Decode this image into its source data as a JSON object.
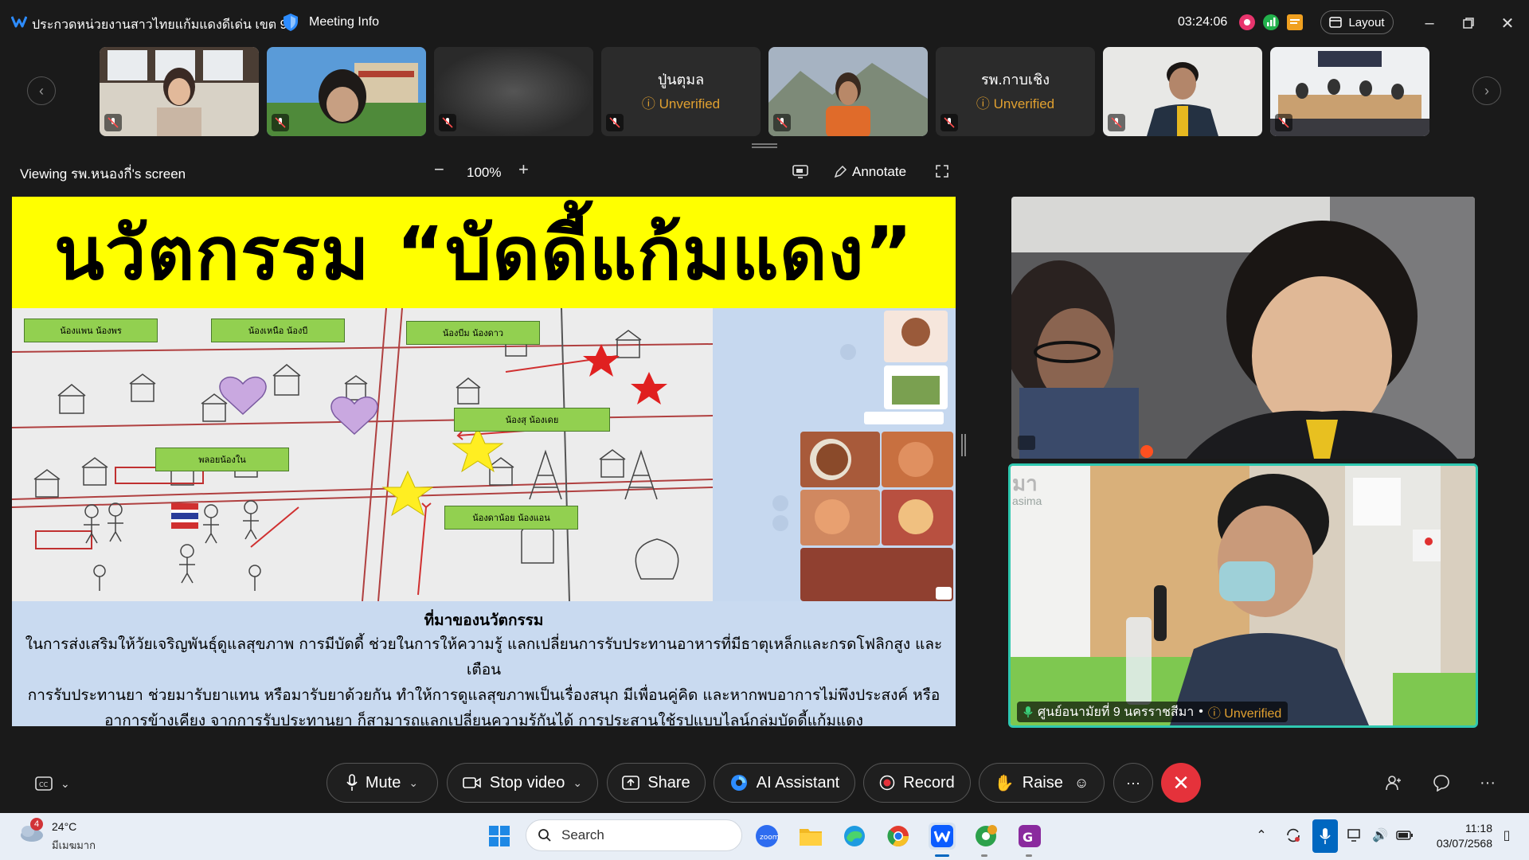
{
  "window": {
    "title": "ประกวดหน่วยงานสาวไทยแก้มแดงดีเด่น เขต 9",
    "meeting_info": "Meeting Info",
    "timer": "03:24:06",
    "layout_label": "Layout"
  },
  "participants": [
    {
      "name": "",
      "status": "",
      "muted": true,
      "kind": "video"
    },
    {
      "name": "",
      "status": "",
      "muted": true,
      "kind": "video"
    },
    {
      "name": "",
      "status": "",
      "muted": true,
      "kind": "video-dark"
    },
    {
      "name": "ปู่นตุมล",
      "status": "Unverified",
      "muted": true,
      "kind": "name"
    },
    {
      "name": "",
      "status": "",
      "muted": true,
      "kind": "video"
    },
    {
      "name": "รพ.กาบเชิง",
      "status": "Unverified",
      "muted": true,
      "kind": "name"
    },
    {
      "name": "",
      "status": "",
      "muted": true,
      "kind": "video"
    },
    {
      "name": "",
      "status": "",
      "muted": true,
      "kind": "video"
    }
  ],
  "share": {
    "viewing_label": "Viewing รพ.หนองกี่'s screen",
    "zoom": "100%",
    "annotate_label": "Annotate"
  },
  "slide": {
    "headline": "นวัตกรรม “บัดดี้แก้มแดง”",
    "map_labels": [
      "น้องแพน น้องพร",
      "น้องเหนือ น้องบี",
      "น้องบีม น้องดาว",
      "น้องสุ น้องเดย",
      "พลอยน้องใน",
      "น้องดาน้อย น้องแอน"
    ],
    "desc_heading": "ที่มาของนวัตกรรม",
    "desc_lines": [
      "ในการส่งเสริมให้วัยเจริญพันธุ์ดูแลสุขภาพ การมีบัดดี้ ช่วยในการให้ความรู้ แลกเปลี่ยนการรับประทานอาหารที่มีธาตุเหล็กและกรดโฟลิกสูง และเตือน",
      "การรับประทานยา ช่วยมารับยาแทน หรือมารับยาด้วยกัน ทำให้การดูแลสุขภาพเป็นเรื่องสนุก มีเพื่อนคู่คิด และหากพบอาการไม่พึงประสงค์ หรือ",
      "อาการข้างเคียง จากการรับประทานยา ก็สามารถแลกเปลี่ยนความรู้กันได้  การประสานใช้รูปแบบไลน์กลุ่มบัดดี้แก้มแดง"
    ]
  },
  "video_panel": {
    "speaker_label": "ศูนย์อนามัยที่ 9 นครราชสีมา",
    "speaker_status": "Unverified",
    "wall_text": "มา",
    "wall_subtext": "asima"
  },
  "toolbar": {
    "mute": "Mute",
    "stop_video": "Stop video",
    "share": "Share",
    "ai_assistant": "AI Assistant",
    "record": "Record",
    "raise": "Raise"
  },
  "taskbar": {
    "weather_temp": "24°C",
    "weather_desc": "มีเมฆมาก",
    "weather_badge": "4",
    "search_placeholder": "Search",
    "time": "11:18",
    "date": "03/07/2568"
  },
  "colors": {
    "accent_teal": "#2fc8b0",
    "end_red": "#e5323b",
    "unverified": "#e0a030",
    "slide_yellow": "#ffff00",
    "label_green": "#92d050"
  }
}
